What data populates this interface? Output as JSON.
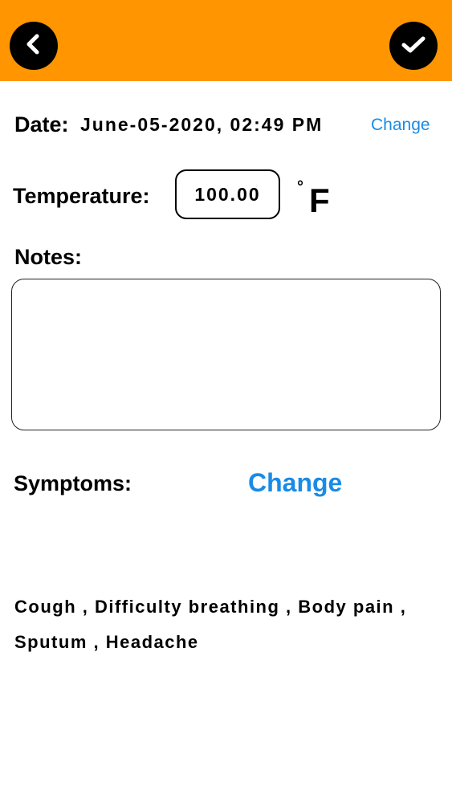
{
  "header": {
    "background_color": "#ff9500",
    "back_icon": "chevron-left-icon",
    "done_icon": "checkmark-icon"
  },
  "date": {
    "label": "Date:",
    "value": "June-05-2020, 02:49 PM",
    "change_label": "Change"
  },
  "temperature": {
    "label": "Temperature:",
    "value": "100.00",
    "degree_symbol": "°",
    "unit": "F"
  },
  "notes": {
    "label": "Notes:",
    "value": ""
  },
  "symptoms": {
    "label": "Symptoms:",
    "change_label": "Change",
    "list_text": "Cough , Difficulty breathing , Body pain , Sputum , Headache"
  },
  "colors": {
    "accent_link": "#1a8be6"
  }
}
